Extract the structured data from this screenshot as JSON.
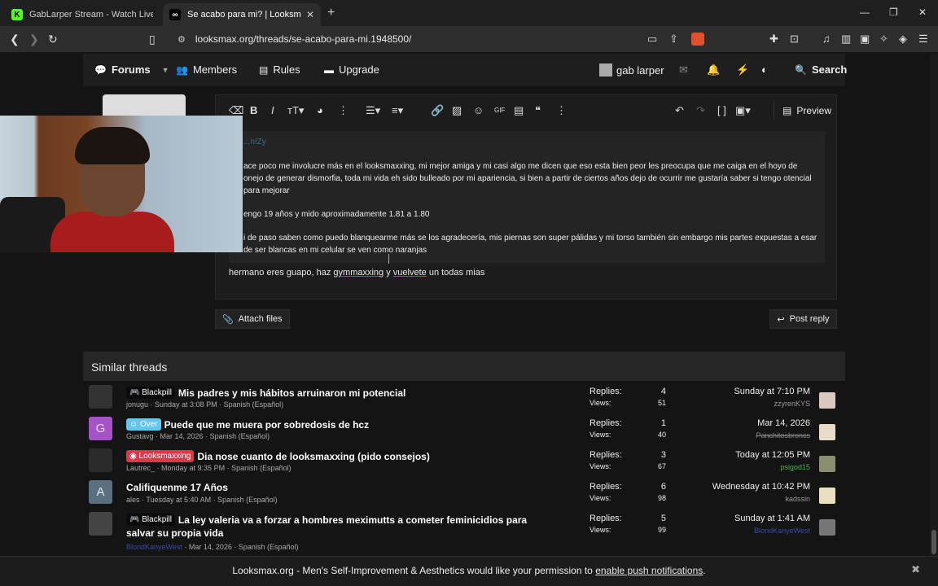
{
  "browser": {
    "tabs": [
      {
        "title": "GabLarper Stream - Watch Live on Ki",
        "favicon_letter": "K",
        "favicon_color": "#53fc18",
        "active": false
      },
      {
        "title": "Se acabo para mi? | Looksmax.or",
        "favicon_letter": "∞",
        "favicon_color": "#000000",
        "active": true
      }
    ],
    "url": "looksmax.org/threads/se-acabo-para-mi.1948500/"
  },
  "forum_nav": {
    "forums": "Forums",
    "members": "Members",
    "rules": "Rules",
    "upgrade": "Upgrade",
    "user": "gab larper",
    "search": "Search"
  },
  "editor": {
    "preview_label": "Preview",
    "quote_head": "...n!Zy",
    "quote_paragraphs": [
      "ace poco me involucre más en el looksmaxxing, mi mejor amiga y mi casi algo me dicen que eso esta bien peor les preocupa que me caiga en el hoyo de onejo de generar dismorfia, toda mi vida eh sido bulleado por mi apariencia, si bien a partir de ciertos años dejo de ocurrir me gustaría saber si tengo otencial para mejorar",
      "engo 19 años y mido aproximadamente 1.81 a 1.80",
      "i de paso saben como puedo blanquearme más se los agradecería, mis piernas son super pálidas y mi torso también sin embargo mis partes expuestas a esar de ser blancas en mi celular se ven como naranjas"
    ],
    "reply_pre": "hermano eres guapo, haz ",
    "reply_misspelled_1": "gymmaxxing",
    "reply_mid": " y ",
    "reply_misspelled_2": "vuelvete",
    "reply_post": " un todas mias",
    "attach_label": "Attach files",
    "post_reply_label": "Post reply"
  },
  "similar_threads": {
    "heading": "Similar threads",
    "replies_label": "Replies:",
    "views_label": "Views:",
    "rows": [
      {
        "avatar_letter": "",
        "avatar_color": "#333333",
        "prefix": "Blackpill",
        "prefix_kind": "black",
        "title": "Mis padres y mis hábitos arruinaron mi potencial",
        "author": "jonugu",
        "meta": " · Sunday at 3:08 PM · Spanish (Español)",
        "replies": "4",
        "views": "51",
        "last_date": "Sunday at 7:10 PM",
        "last_user": "zzyrenKYS",
        "last_user_color": "#999999"
      },
      {
        "avatar_letter": "G",
        "avatar_color": "#a653c8",
        "prefix": "Over",
        "prefix_kind": "over",
        "title": "Puede que me muera por sobredosis de hcz",
        "author": "Gustavg",
        "meta": " · Mar 14, 2026 · Spanish (Español)",
        "replies": "1",
        "views": "40",
        "last_date": "Mar 14, 2026",
        "last_user": "Panchitosbroncs",
        "last_user_color": "#888888"
      },
      {
        "avatar_letter": "",
        "avatar_color": "#2a2a2a",
        "prefix": "Looksmaxxing",
        "prefix_kind": "looks",
        "title": "Dia nose cuanto de looksmaxxing (pido consejos)",
        "author": "Lautrec_",
        "meta": " · Monday at 9:35 PM · Spanish (Español)",
        "replies": "3",
        "views": "67",
        "last_date": "Today at 12:05 PM",
        "last_user": "psigod15",
        "last_user_color": "#4caf50"
      },
      {
        "avatar_letter": "A",
        "avatar_color": "#5a6f80",
        "prefix": "",
        "prefix_kind": "",
        "title": "Califiquenme 17 Años",
        "author": "ales",
        "meta": " · Tuesday at 5:40 AM · Spanish (Español)",
        "replies": "6",
        "views": "98",
        "last_date": "Wednesday at 10:42 PM",
        "last_user": "kadssin",
        "last_user_color": "#999999"
      },
      {
        "avatar_letter": "",
        "avatar_color": "#444444",
        "prefix": "Blackpill",
        "prefix_kind": "black",
        "title": "La ley valeria va a forzar a hombres meximutts a cometer feminicidios para",
        "title2": "salvar su propia vida",
        "author": "BlondKanyeWest",
        "meta": " · Mar 14, 2026 · Spanish (Español)",
        "replies": "5",
        "views": "99",
        "last_date": "Sunday at 1:41 AM",
        "last_user": "BlondKanyeWest",
        "last_user_color": "#3a4aa8"
      }
    ]
  },
  "notice": {
    "text_pre": "Looksmax.org - Men's Self-Improvement & Aesthetics would like your permission to ",
    "link": "enable push notifications",
    "text_post": "."
  }
}
